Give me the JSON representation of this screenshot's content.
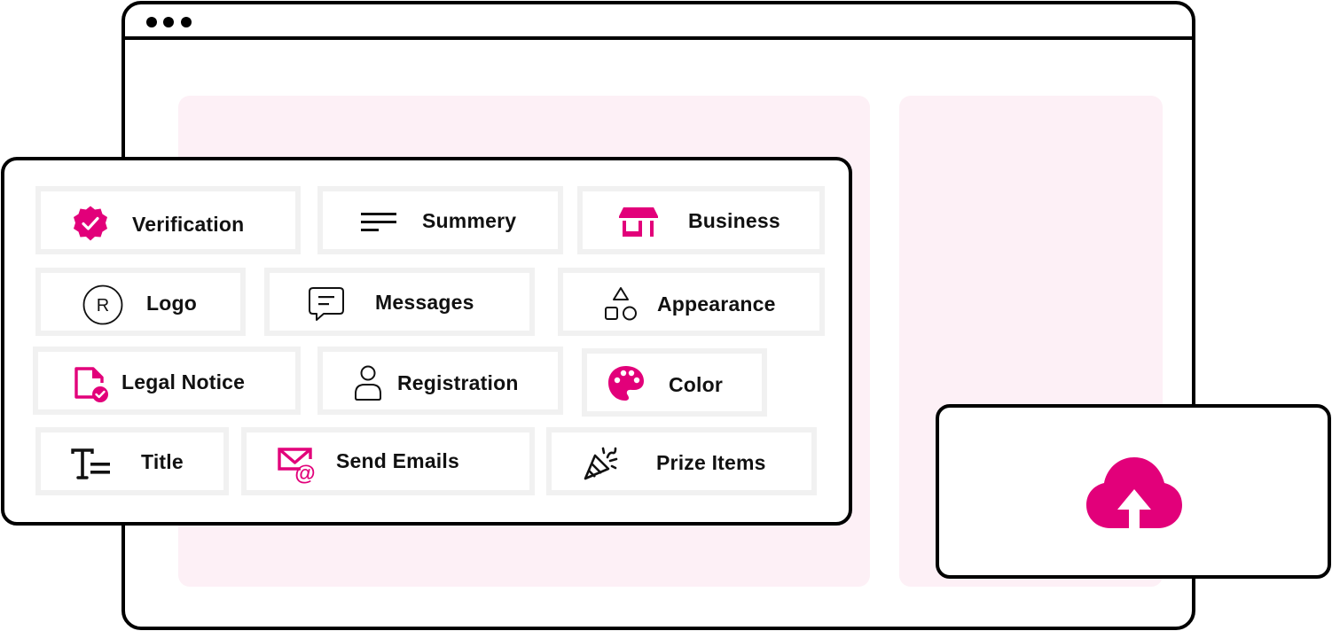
{
  "window": {
    "controls": [
      "dot",
      "dot",
      "dot"
    ]
  },
  "colors": {
    "accent": "#e2007a",
    "panel_background": "#fdf0f6",
    "tile_border": "#f1f1f1",
    "outline": "#000000"
  },
  "settings": {
    "items": [
      {
        "label": "Verification",
        "icon": "verified-badge-icon"
      },
      {
        "label": "Summery",
        "icon": "text-lines-icon"
      },
      {
        "label": "Business",
        "icon": "storefront-icon"
      },
      {
        "label": "Logo",
        "icon": "registered-mark-icon"
      },
      {
        "label": "Messages",
        "icon": "chat-bubble-icon"
      },
      {
        "label": "Appearance",
        "icon": "shapes-icon"
      },
      {
        "label": "Legal Notice",
        "icon": "document-check-icon"
      },
      {
        "label": "Registration",
        "icon": "user-icon"
      },
      {
        "label": "Color",
        "icon": "palette-icon"
      },
      {
        "label": "Title",
        "icon": "text-title-icon"
      },
      {
        "label": "Send Emails",
        "icon": "mail-at-icon"
      },
      {
        "label": "Prize Items",
        "icon": "party-popper-icon"
      }
    ]
  },
  "upload": {
    "icon": "cloud-upload-icon"
  }
}
